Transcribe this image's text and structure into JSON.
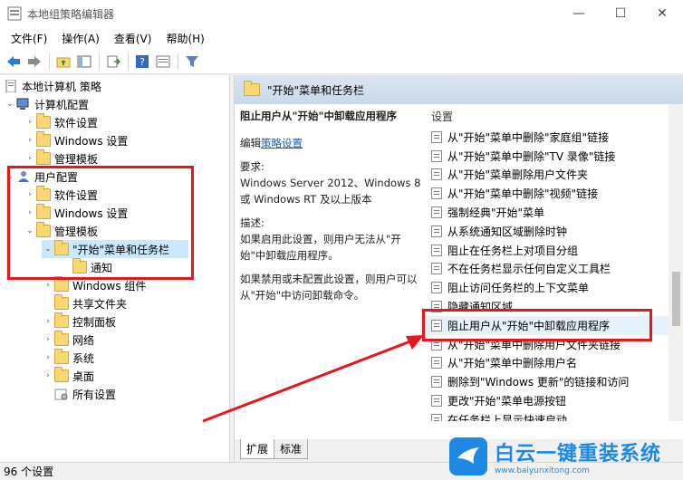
{
  "window": {
    "title": "本地组策略编辑器",
    "controls": {
      "minimize": "—",
      "maximize": "☐",
      "close": "✕"
    }
  },
  "menu": [
    "文件(F)",
    "操作(A)",
    "查看(V)",
    "帮助(H)"
  ],
  "tree": {
    "root": "本地计算机 策略",
    "computer_config": "计算机配置",
    "cc_software": "软件设置",
    "cc_windows": "Windows 设置",
    "cc_admin": "管理模板",
    "user_config": "用户配置",
    "uc_software": "软件设置",
    "uc_windows": "Windows 设置",
    "uc_admin": "管理模板",
    "start_menu": "\"开始\"菜单和任务栏",
    "notify": "通知",
    "win_components": "Windows 组件",
    "shared": "共享文件夹",
    "control_panel": "控制面板",
    "network": "网络",
    "system": "系统",
    "desktop": "桌面",
    "all_settings": "所有设置"
  },
  "right": {
    "header": "\"开始\"菜单和任务栏",
    "desc_title": "阻止用户从\"开始\"中卸载应用程序",
    "edit_prefix": "编辑",
    "edit_link": "策略设置",
    "req_label": "要求:",
    "req_text": "Windows Server 2012、Windows 8 或 Windows RT 及以上版本",
    "desc_label": "描述:",
    "desc_text": "如果启用此设置，则用户无法从\"开始\"中卸载应用程序。",
    "desc_text2": "如果禁用或未配置此设置，则用户可以从\"开始\"中访问卸载命令。",
    "list_header": "设置",
    "items": [
      "从\"开始\"菜单中删除\"家庭组\"链接",
      "从\"开始\"菜单中删除\"TV 录像\"链接",
      "从\"开始\"菜单删除用户文件夹",
      "从\"开始\"菜单中删除\"视频\"链接",
      "强制经典\"开始\"菜单",
      "从系统通知区域删除时钟",
      "阻止在任务栏上对项目分组",
      "不在任务栏显示任何自定义工具栏",
      "阻止访问任务栏的上下文菜单",
      "隐藏通知区域",
      "阻止用户从\"开始\"中卸载应用程序",
      "从\"开始\"菜单中删除用户文件夹链接",
      "从\"开始\"菜单中删除用户名",
      "删除到\"Windows 更新\"的链接和访问",
      "更改\"开始\"菜单电源按钮",
      "在任务栏上显示快速启动"
    ],
    "tabs": [
      "扩展",
      "标准"
    ]
  },
  "status": "96 个设置",
  "watermark": {
    "big": "白云一键重装系统",
    "small": "www.baiyunxitong.com"
  },
  "colors": {
    "highlight_red": "#e8161b",
    "accent_blue": "#1e88e5"
  }
}
